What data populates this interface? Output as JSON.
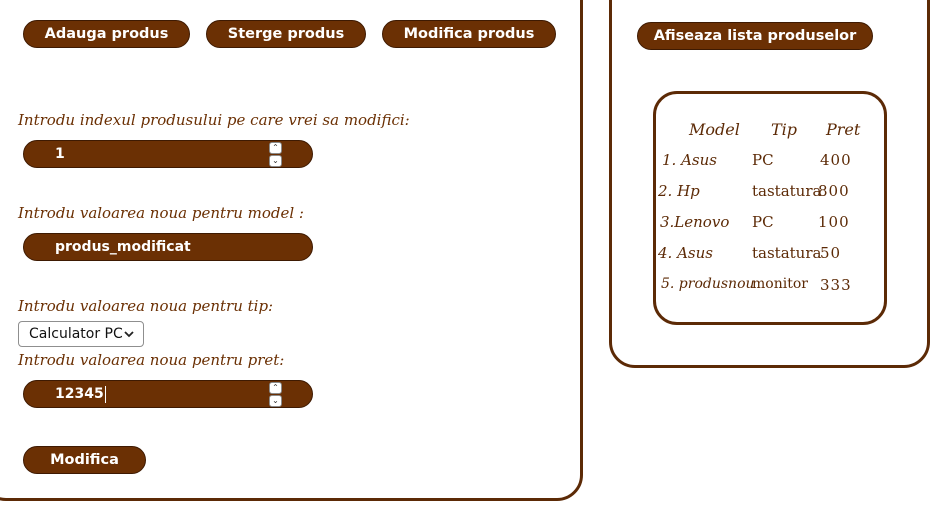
{
  "toolbar": {
    "add_label": "Adauga produs",
    "delete_label": "Sterge produs",
    "modify_label": "Modifica produs"
  },
  "form": {
    "index_label": "Introdu indexul produsului pe care vrei sa modifici:",
    "index_value": "1",
    "model_label": "Introdu valoarea noua pentru model :",
    "model_value": "produs_modificat",
    "type_label": "Introdu valoarea noua pentru tip:",
    "type_selected": "Calculator PC",
    "price_label": "Introdu valoarea noua pentru pret:",
    "price_value": "12345",
    "submit_label": "Modifica"
  },
  "product_list": {
    "show_button_label": "Afiseaza lista produselor",
    "headers": [
      "Model",
      "Tip",
      "Pret"
    ],
    "rows": [
      {
        "model": "1. Asus",
        "type": "PC",
        "price": "400"
      },
      {
        "model": "2. Hp",
        "type": "tastatura",
        "price": "800"
      },
      {
        "model": "3.Lenovo",
        "type": "PC",
        "price": "100"
      },
      {
        "model": "4. Asus",
        "type": "tastatura",
        "price": "50"
      },
      {
        "model": "5. produsnou",
        "type": "monitor",
        "price": "333"
      }
    ]
  },
  "colors": {
    "accent": "#6b3004",
    "border": "#5c2a06",
    "text_on_accent": "#ffffff"
  },
  "icons": {
    "spinner": "up-down-arrows-icon",
    "dropdown": "chevron-down-icon"
  }
}
